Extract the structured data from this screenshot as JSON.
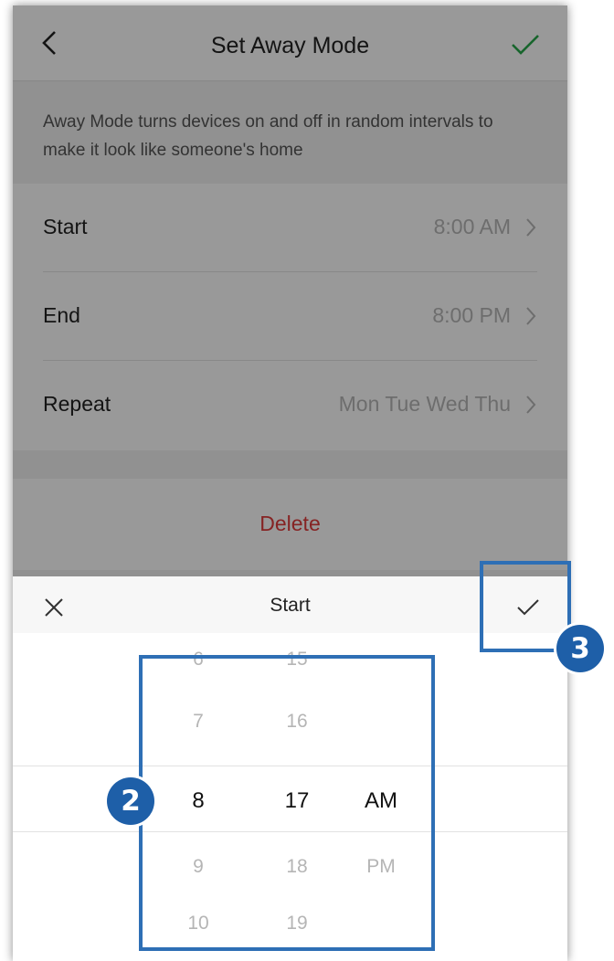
{
  "nav": {
    "title": "Set Away Mode"
  },
  "description": "Away Mode turns devices on and off in random intervals to make it look like someone's home",
  "settings": [
    {
      "label": "Start",
      "value": "8:00 AM"
    },
    {
      "label": "End",
      "value": "8:00 PM"
    },
    {
      "label": "Repeat",
      "value": "Mon Tue Wed Thu"
    }
  ],
  "delete_label": "Delete",
  "picker": {
    "title": "Start",
    "hours": [
      "6",
      "7",
      "8",
      "9",
      "10"
    ],
    "minutes": [
      "15",
      "16",
      "17",
      "18",
      "19"
    ],
    "periods": [
      "AM",
      "PM"
    ],
    "selected": {
      "hour": "8",
      "minute": "17",
      "period": "AM"
    }
  },
  "annotations": {
    "badge_2": "2",
    "badge_3": "3"
  },
  "colors": {
    "accent_green": "#27a84a",
    "delete_red": "#e03b3b",
    "highlight_blue": "#2e6fb5"
  }
}
